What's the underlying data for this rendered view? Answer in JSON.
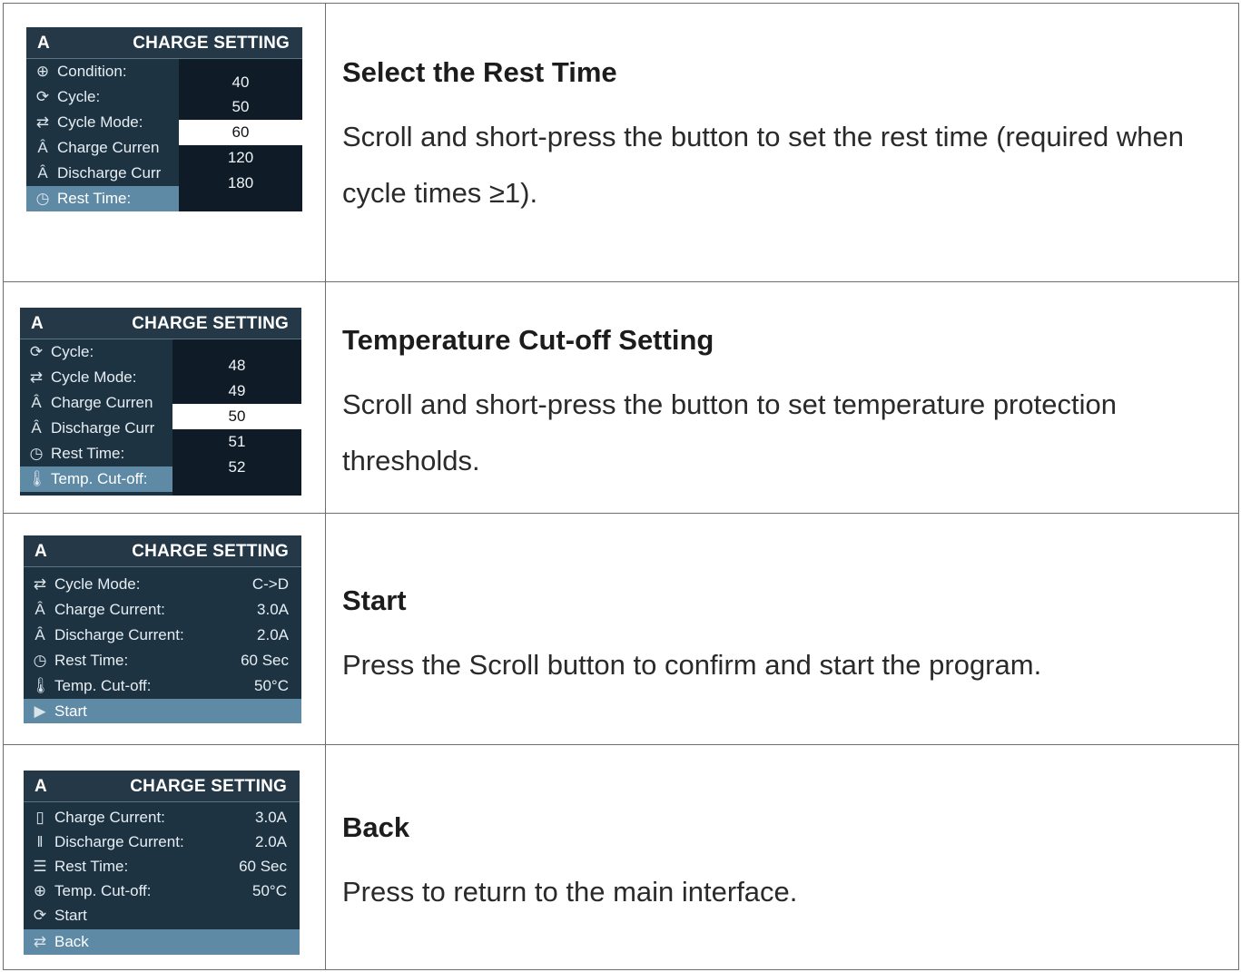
{
  "rows": [
    {
      "title": "Select the Rest Time",
      "body": "Scroll and short-press the button to set the rest time  (required when cycle times ≥1).",
      "screen": {
        "header_left": "A",
        "header_title": "CHARGE SETTING",
        "items": [
          {
            "icon": "condition-icon",
            "glyph": "⊕",
            "label": "Condition:"
          },
          {
            "icon": "cycle-icon",
            "glyph": "⟳",
            "label": "Cycle:"
          },
          {
            "icon": "cycle-mode-icon",
            "glyph": "⇄",
            "label": "Cycle Mode:"
          },
          {
            "icon": "charge-current-icon",
            "glyph": "Â",
            "label": "Charge Curren"
          },
          {
            "icon": "discharge-current-icon",
            "glyph": "Â",
            "label": "Discharge Curr"
          },
          {
            "icon": "rest-time-icon",
            "glyph": "◷",
            "label": "Rest Time:"
          }
        ],
        "options": [
          "40",
          "50",
          "60",
          "120",
          "180"
        ],
        "selected_option": "60"
      }
    },
    {
      "title": "Temperature Cut-off Setting",
      "body": "Scroll and short-press the button to set temperature protection thresholds.",
      "screen": {
        "header_left": "A",
        "header_title": "CHARGE SETTING",
        "items": [
          {
            "icon": "cycle-icon",
            "glyph": "⟳",
            "label": "Cycle:"
          },
          {
            "icon": "cycle-mode-icon",
            "glyph": "⇄",
            "label": "Cycle Mode:"
          },
          {
            "icon": "charge-current-icon",
            "glyph": "Â",
            "label": "Charge Curren"
          },
          {
            "icon": "discharge-current-icon",
            "glyph": "Â",
            "label": "Discharge Curr"
          },
          {
            "icon": "rest-time-icon",
            "glyph": "◷",
            "label": "Rest Time:"
          },
          {
            "icon": "thermometer-icon",
            "glyph": "🌡",
            "label": "Temp. Cut-off:"
          }
        ],
        "options": [
          "48",
          "49",
          "50",
          "51",
          "52"
        ],
        "selected_option": "50"
      }
    },
    {
      "title": "Start",
      "body": "Press the Scroll button to confirm and start the program.",
      "screen": {
        "header_left": "A",
        "header_title": "CHARGE SETTING",
        "items": [
          {
            "icon": "cycle-mode-icon",
            "glyph": "⇄",
            "label": "Cycle Mode:",
            "value": "C->D"
          },
          {
            "icon": "charge-current-icon",
            "glyph": "Â",
            "label": "Charge Current:",
            "value": "3.0A"
          },
          {
            "icon": "discharge-current-icon",
            "glyph": "Â",
            "label": "Discharge Current:",
            "value": "2.0A"
          },
          {
            "icon": "rest-time-icon",
            "glyph": "◷",
            "label": "Rest Time:",
            "value": "60 Sec"
          },
          {
            "icon": "thermometer-icon",
            "glyph": "🌡",
            "label": "Temp. Cut-off:",
            "value": "50°C"
          },
          {
            "icon": "play-icon",
            "glyph": "▶",
            "label": "Start",
            "value": ""
          }
        ]
      }
    },
    {
      "title": "Back",
      "body": "Press to return to the main interface.",
      "screen": {
        "header_left": "A",
        "header_title": "CHARGE SETTING",
        "items": [
          {
            "icon": "battery-icon",
            "glyph": "▯",
            "label": "Charge Current:",
            "value": "3.0A"
          },
          {
            "icon": "discharge-bars-icon",
            "glyph": "‖",
            "label": "Discharge Current:",
            "value": "2.0A"
          },
          {
            "icon": "list-icon",
            "glyph": "☰",
            "label": "Rest Time:",
            "value": "60 Sec"
          },
          {
            "icon": "condition-icon",
            "glyph": "⊕",
            "label": "Temp. Cut-off:",
            "value": "50°C"
          },
          {
            "icon": "cycle-icon",
            "glyph": "⟳",
            "label": "Start",
            "value": ""
          },
          {
            "icon": "cycle-mode-icon",
            "glyph": "⇄",
            "label": "Back",
            "value": ""
          }
        ]
      }
    }
  ]
}
